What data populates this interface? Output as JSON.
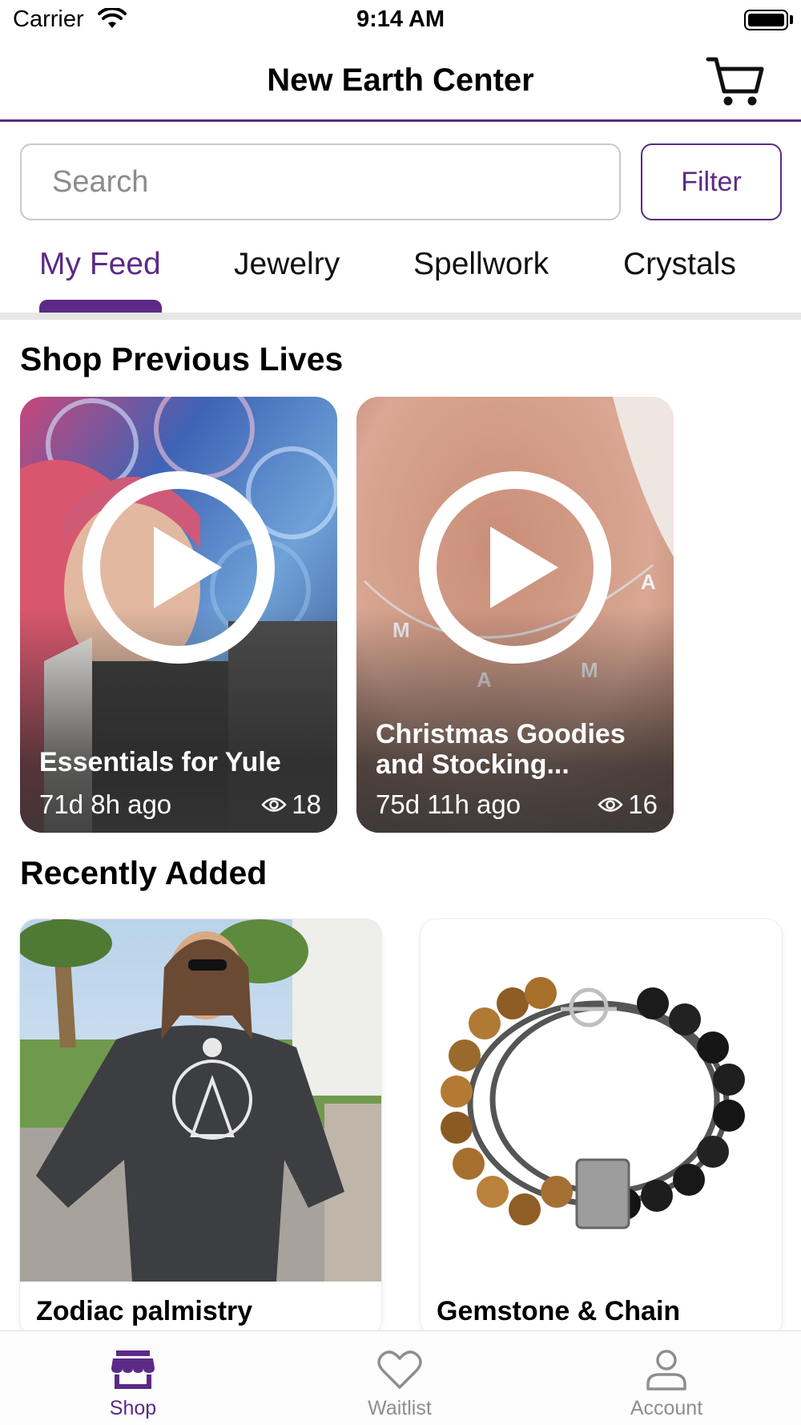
{
  "status_bar": {
    "carrier": "Carrier",
    "time": "9:14 AM"
  },
  "nav": {
    "title": "New Earth Center",
    "cart_icon": "cart-icon"
  },
  "search": {
    "placeholder": "Search",
    "value": ""
  },
  "filter": {
    "label": "Filter"
  },
  "tabs": [
    {
      "label": "My Feed",
      "active": true
    },
    {
      "label": "Jewelry",
      "active": false
    },
    {
      "label": "Spellwork",
      "active": false
    },
    {
      "label": "Crystals",
      "active": false
    }
  ],
  "previous_lives": {
    "title": "Shop Previous Lives",
    "items": [
      {
        "title": "Essentials for Yule",
        "time": "71d 8h ago",
        "views": "18"
      },
      {
        "title": "Christmas Goodies and Stocking...",
        "time": "75d 11h ago",
        "views": "16"
      }
    ]
  },
  "recently_added": {
    "title": "Recently Added",
    "items": [
      {
        "name": "Zodiac palmistry"
      },
      {
        "name": "Gemstone & Chain"
      }
    ]
  },
  "tab_bar": [
    {
      "label": "Shop",
      "icon": "store-icon",
      "active": true
    },
    {
      "label": "Waitlist",
      "icon": "heart-icon",
      "active": false
    },
    {
      "label": "Account",
      "icon": "person-icon",
      "active": false
    }
  ],
  "colors": {
    "accent": "#5b2a86",
    "divider": "#e6e6e6",
    "inactive": "#8e8e8e"
  }
}
